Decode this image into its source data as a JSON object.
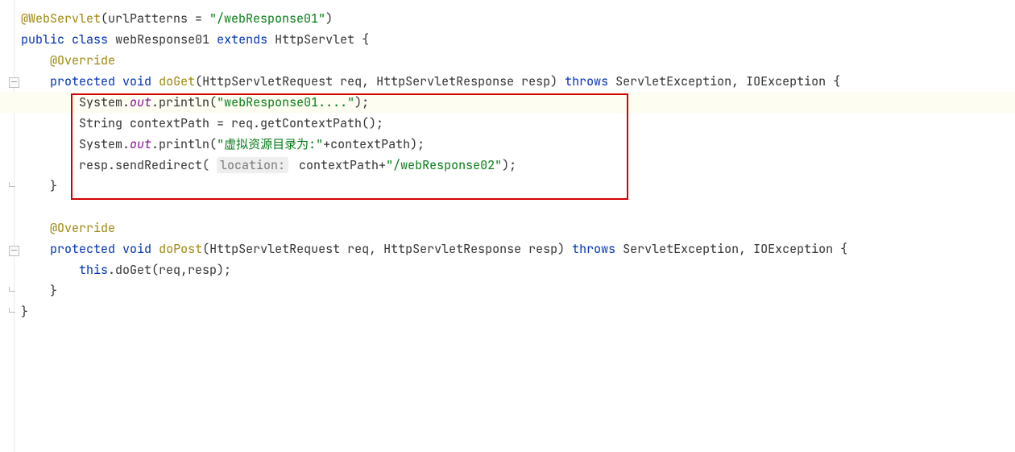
{
  "code": {
    "annotation_name": "@WebServlet",
    "urlPatterns_attr": "urlPatterns = ",
    "urlPatterns_value": "\"/webResponse01\"",
    "class_decl_1": "public",
    "class_decl_2": "class",
    "class_name": "webResponse01",
    "extends_kw": "extends",
    "superclass": "HttpServlet {",
    "override1": "@Override",
    "doGet_mods": "protected",
    "void_kw": "void",
    "doGet_name": "doGet",
    "doGet_sig_open": "(HttpServletRequest req, HttpServletResponse resp) ",
    "throws_kw": "throws",
    "doGet_throws": " ServletException, IOException {",
    "sys": "System.",
    "out": "out",
    "println": ".println(",
    "str1": "\"webResponse01....\"",
    "str1_end": ");",
    "line5": "String contextPath = req.getContextPath();",
    "str2": "\"虚拟资源目录为:\"",
    "str2_tail": "+contextPath);",
    "resp_redirect": "resp.sendRedirect( ",
    "inlay_location": "location:",
    "ctx_plus": " contextPath+",
    "str3": "\"/webResponse02\"",
    "str3_end": ");",
    "brace_close": "}",
    "override2": "@Override",
    "doPost_name": "doPost",
    "doPost_sig_open": "(HttpServletRequest req, HttpServletResponse resp) ",
    "this_kw": "this",
    "this_tail": ".doGet(req,resp);"
  }
}
